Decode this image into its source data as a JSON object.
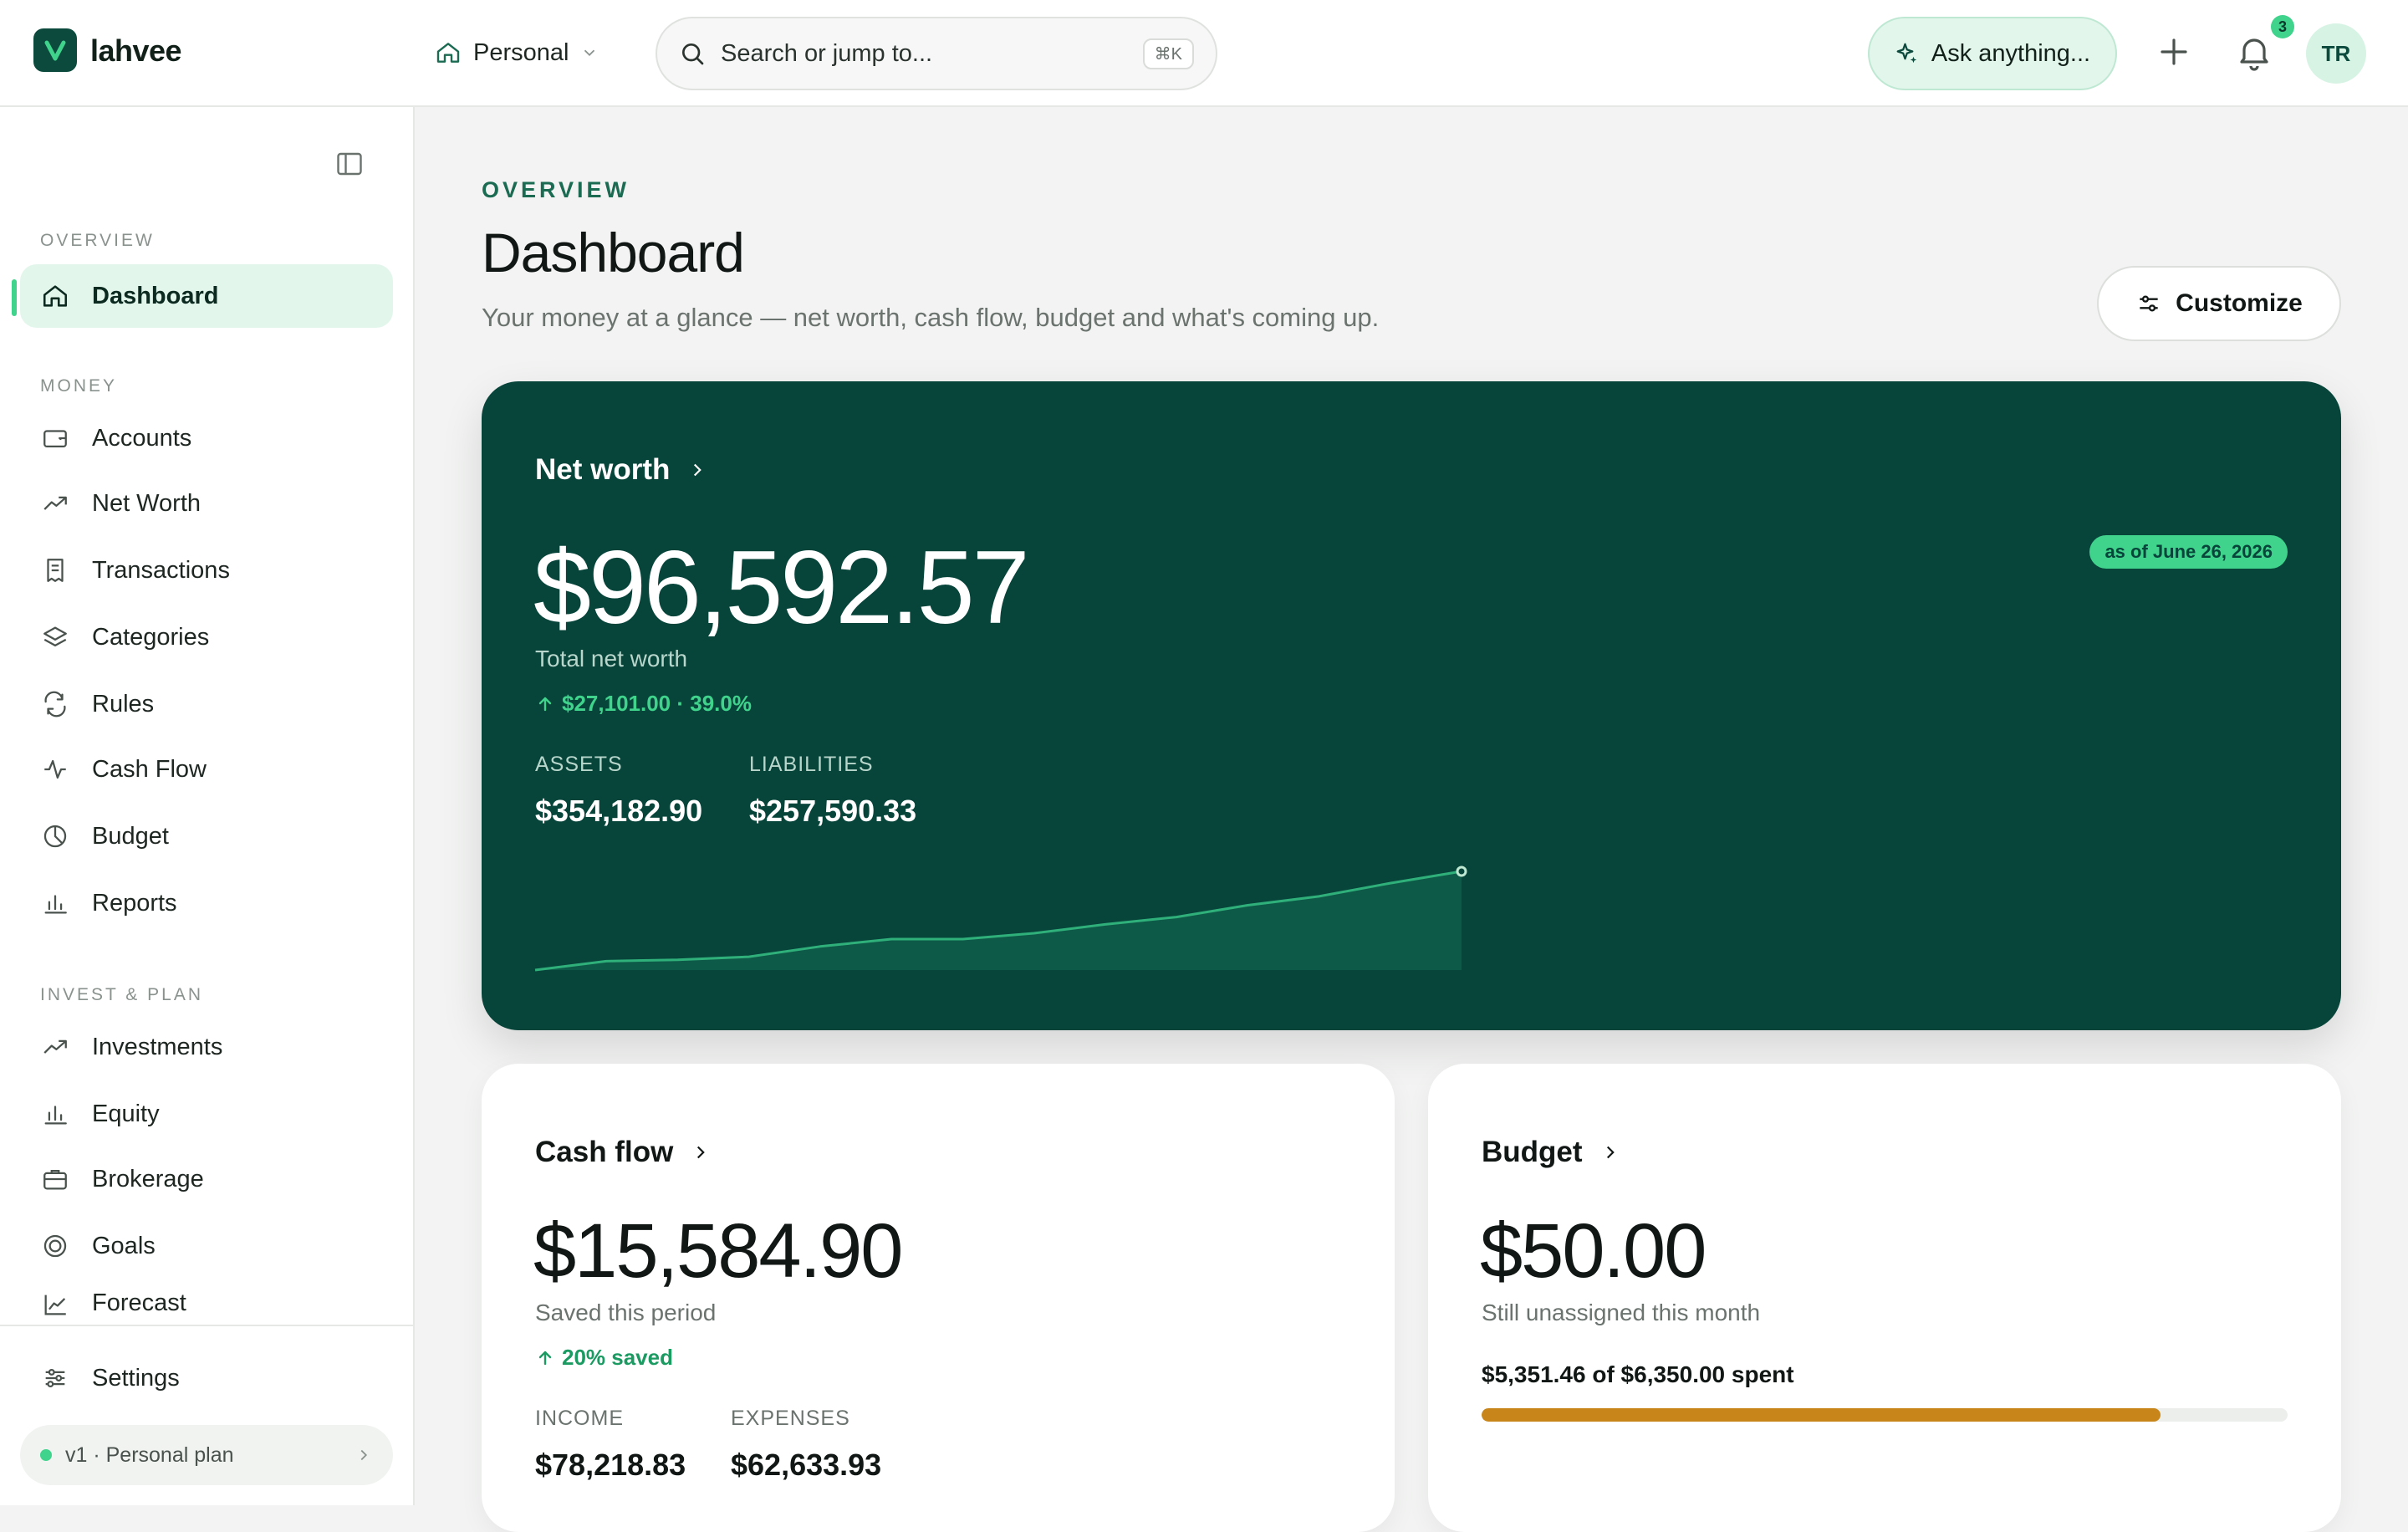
{
  "app": {
    "brand": "lahvee",
    "logo_letter": "V"
  },
  "topbar": {
    "workspace": "Personal",
    "search_placeholder": "Search or jump to...",
    "search_shortcut": "⌘K",
    "ask_label": "Ask anything...",
    "notifications_count": "3",
    "avatar_initials": "TR"
  },
  "sidebar": {
    "sections": {
      "overview": "OVERVIEW",
      "money": "MONEY",
      "invest": "INVEST & PLAN"
    },
    "items": [
      {
        "label": "Dashboard",
        "icon": "home-icon"
      },
      {
        "label": "Accounts",
        "icon": "wallet-icon"
      },
      {
        "label": "Net Worth",
        "icon": "trending-up-icon"
      },
      {
        "label": "Transactions",
        "icon": "receipt-icon"
      },
      {
        "label": "Categories",
        "icon": "layers-icon"
      },
      {
        "label": "Rules",
        "icon": "repeat-icon"
      },
      {
        "label": "Cash Flow",
        "icon": "activity-icon"
      },
      {
        "label": "Budget",
        "icon": "pie-icon"
      },
      {
        "label": "Reports",
        "icon": "bar-chart-icon"
      },
      {
        "label": "Investments",
        "icon": "trending-up-icon"
      },
      {
        "label": "Equity",
        "icon": "bar-chart-icon"
      },
      {
        "label": "Brokerage",
        "icon": "briefcase-icon"
      },
      {
        "label": "Goals",
        "icon": "target-icon"
      },
      {
        "label": "Forecast",
        "icon": "line-chart-icon"
      }
    ],
    "settings_label": "Settings",
    "plan_label": "v1 · Personal plan"
  },
  "page": {
    "eyebrow": "OVERVIEW",
    "title": "Dashboard",
    "subtitle": "Your money at a glance — net worth, cash flow, budget and what's coming up.",
    "customize_label": "Customize"
  },
  "net_worth": {
    "title": "Net worth",
    "value": "$96,592.57",
    "label": "Total net worth",
    "change": "$27,101.00 · 39.0%",
    "as_of": "as of June 26, 2026",
    "assets_label": "ASSETS",
    "assets_value": "$354,182.90",
    "liabilities_label": "LIABILITIES",
    "liabilities_value": "$257,590.33",
    "trend": [
      0,
      0.12,
      0.14,
      0.18,
      0.32,
      0.42,
      0.42,
      0.5,
      0.62,
      0.72,
      0.88,
      1.0,
      1.18,
      1.34
    ]
  },
  "cash_flow": {
    "title": "Cash flow",
    "value": "$15,584.90",
    "label": "Saved this period",
    "change": "20% saved",
    "income_label": "INCOME",
    "income_value": "$78,218.83",
    "expenses_label": "EXPENSES",
    "expenses_value": "$62,633.93"
  },
  "budget": {
    "title": "Budget",
    "value": "$50.00",
    "label": "Still unassigned this month",
    "spent_text": "$5,351.46 of $6,350.00 spent",
    "spent_fraction": 0.8427
  },
  "colors": {
    "accent": "#3fd38c",
    "brand_dark": "#07443a",
    "budget_bar": "#c8861a"
  }
}
